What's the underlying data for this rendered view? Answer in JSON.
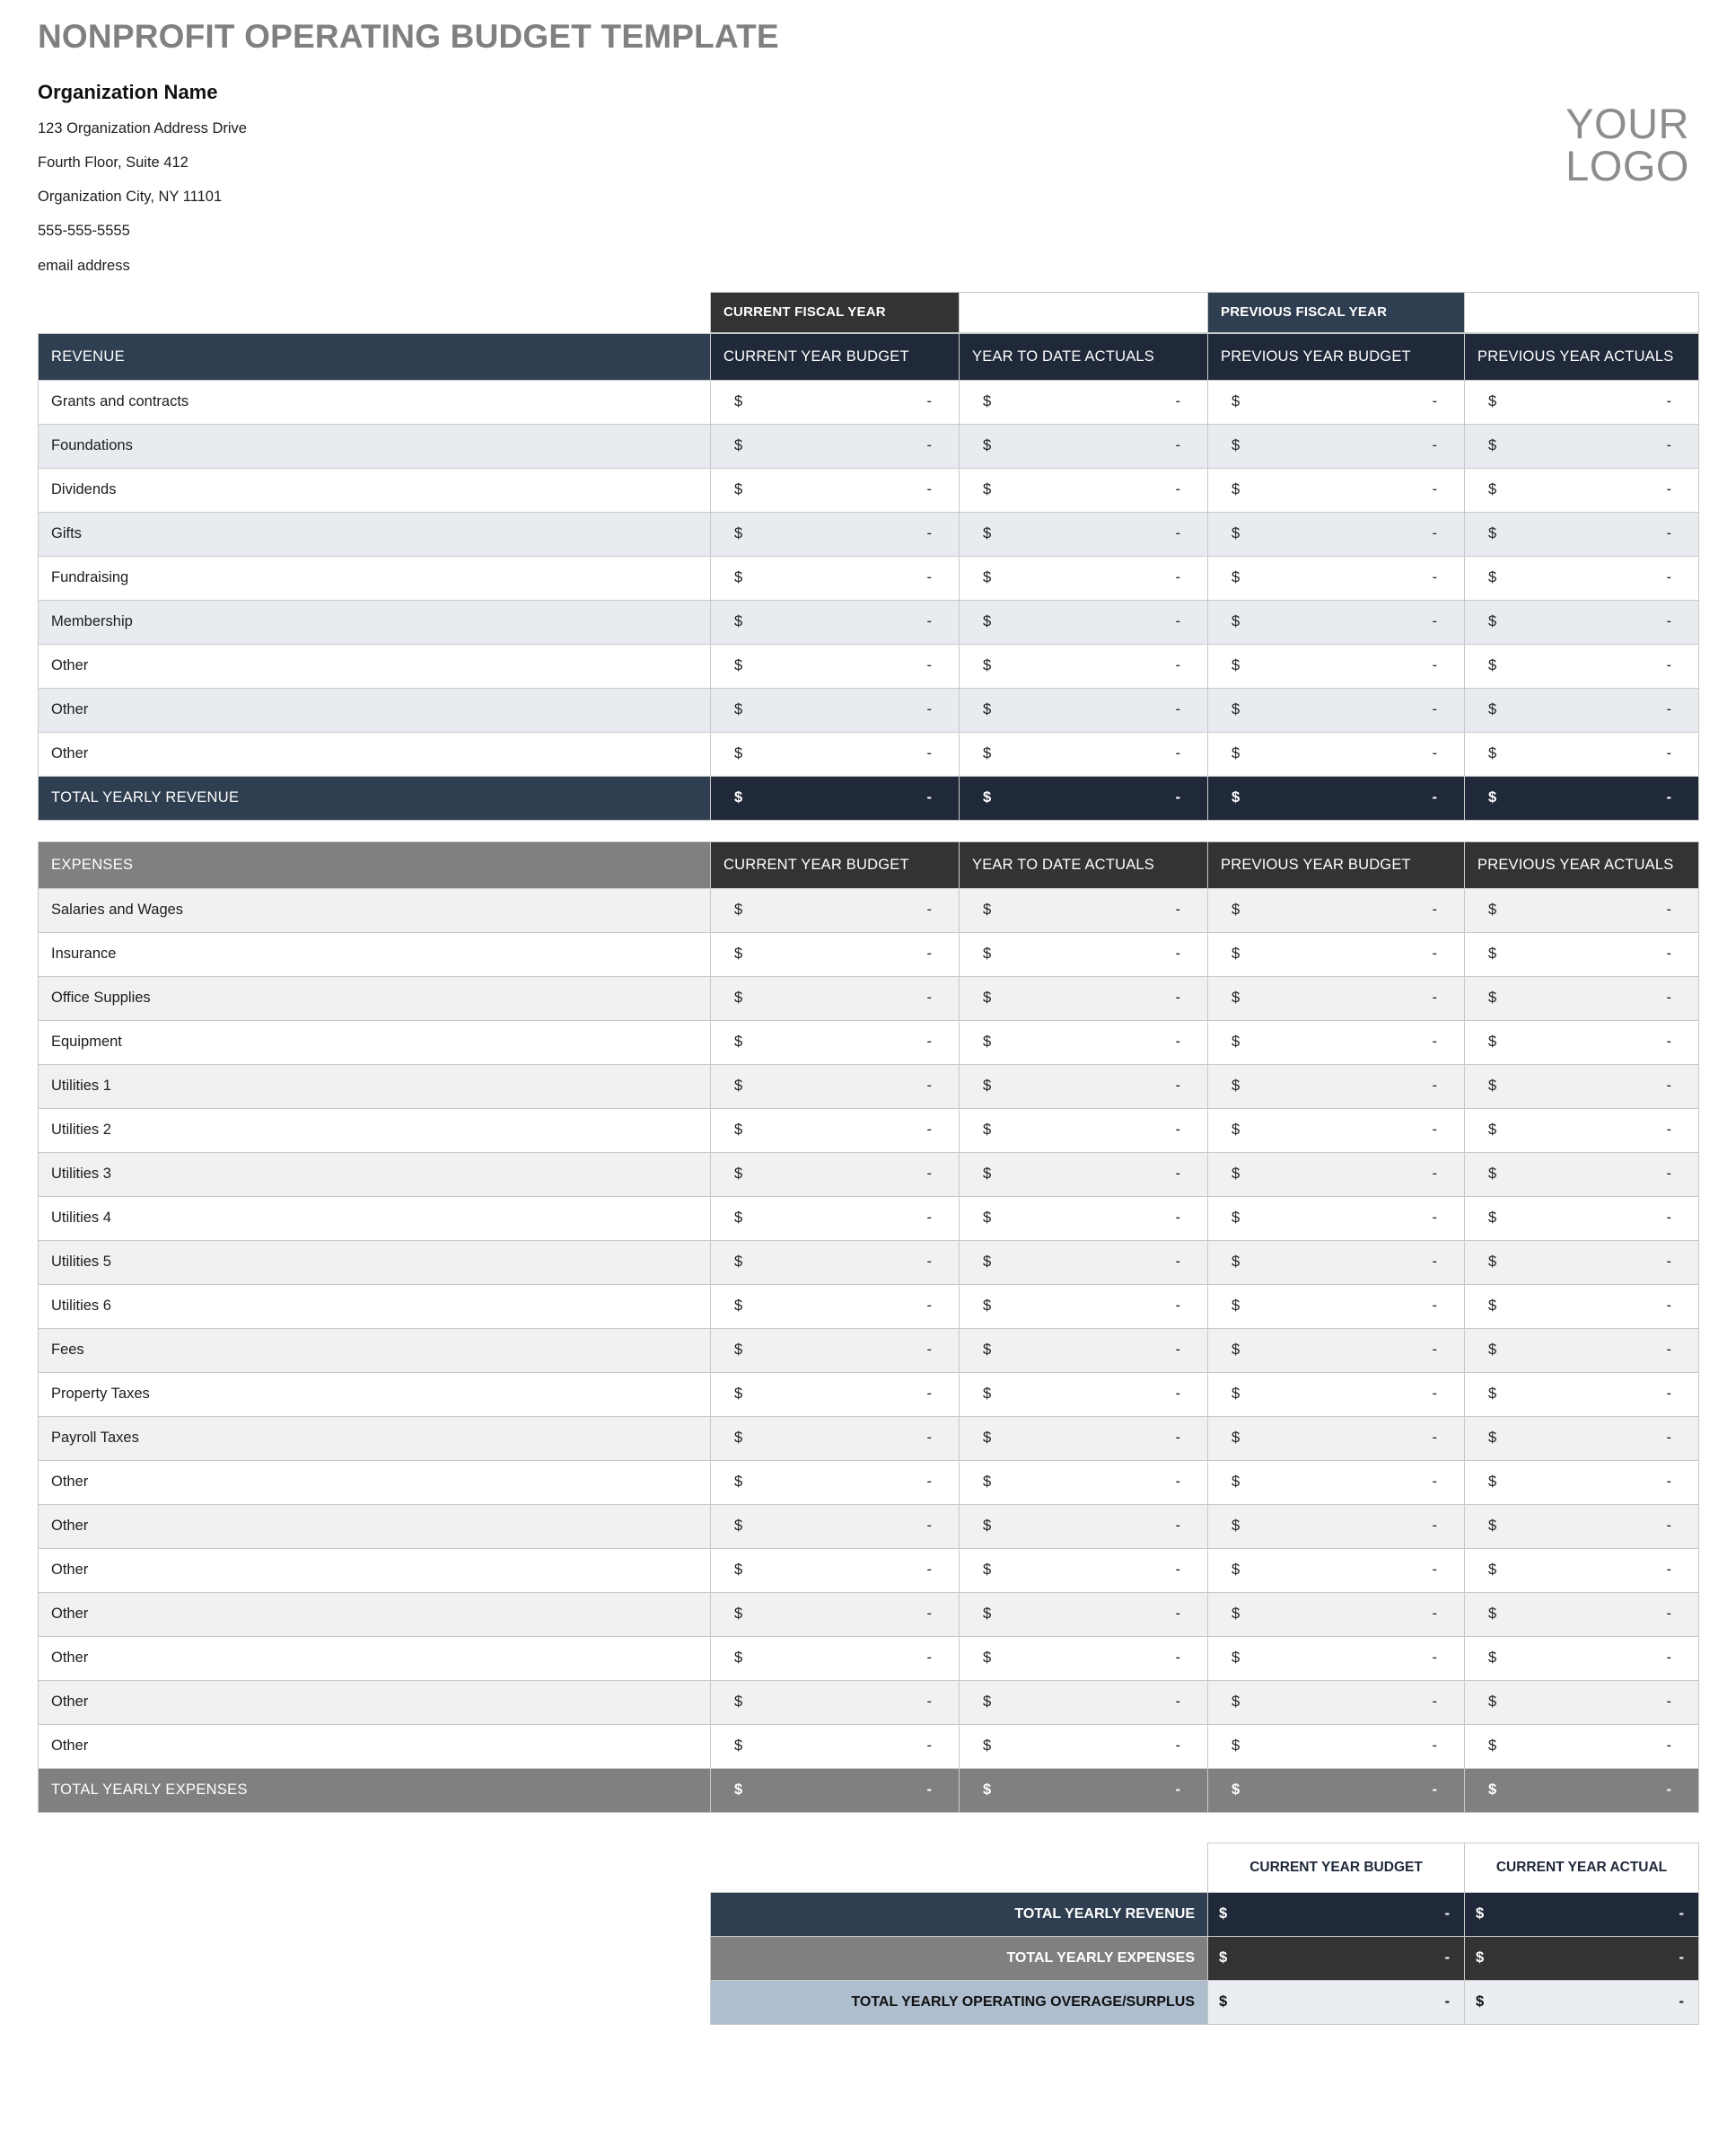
{
  "document": {
    "title": "NONPROFIT OPERATING BUDGET TEMPLATE",
    "logo_line1": "YOUR",
    "logo_line2": "LOGO"
  },
  "organization": {
    "name": "Organization Name",
    "address_line1": "123 Organization Address Drive",
    "address_line2": "Fourth Floor, Suite 412",
    "address_line3": "Organization City, NY  11101",
    "phone": "555-555-5555",
    "email": "email address"
  },
  "fiscal_year_bar": {
    "current": "CURRENT FISCAL YEAR",
    "current_value": "",
    "previous": "PREVIOUS FISCAL YEAR",
    "previous_value": ""
  },
  "columns": {
    "current_year_budget": "CURRENT YEAR BUDGET",
    "year_to_date_actuals": "YEAR TO DATE ACTUALS",
    "previous_year_budget": "PREVIOUS YEAR BUDGET",
    "previous_year_actuals": "PREVIOUS YEAR ACTUALS"
  },
  "cell": {
    "currency": "$",
    "value": "-"
  },
  "revenue": {
    "header": "REVENUE",
    "rows": [
      "Grants and contracts",
      "Foundations",
      "Dividends",
      "Gifts",
      "Fundraising",
      "Membership",
      "Other",
      "Other",
      "Other"
    ],
    "total_label": "TOTAL YEARLY REVENUE"
  },
  "expenses": {
    "header": "EXPENSES",
    "rows": [
      "Salaries and Wages",
      "Insurance",
      "Office Supplies",
      "Equipment",
      "Utilities 1",
      "Utilities 2",
      "Utilities 3",
      "Utilities 4",
      "Utilities 5",
      "Utilities 6",
      "Fees",
      "Property Taxes",
      "Payroll Taxes",
      "Other",
      "Other",
      "Other",
      "Other",
      "Other",
      "Other",
      "Other"
    ],
    "total_label": "TOTAL YEARLY EXPENSES"
  },
  "summary": {
    "col_budget": "CURRENT YEAR BUDGET",
    "col_actual": "CURRENT YEAR ACTUAL",
    "rows": [
      {
        "label": "TOTAL YEARLY REVENUE"
      },
      {
        "label": "TOTAL YEARLY EXPENSES"
      },
      {
        "label": "TOTAL YEARLY OPERATING OVERAGE/SURPLUS"
      }
    ]
  },
  "colors": {
    "navy": "#2f3e50",
    "dark_navy": "#20293a",
    "charcoal": "#333333",
    "gray": "#808080",
    "light_blue": "#aebecf",
    "row_blue": "#e8ecf1",
    "row_gray": "#f1f1f1",
    "title_gray": "#808080"
  }
}
